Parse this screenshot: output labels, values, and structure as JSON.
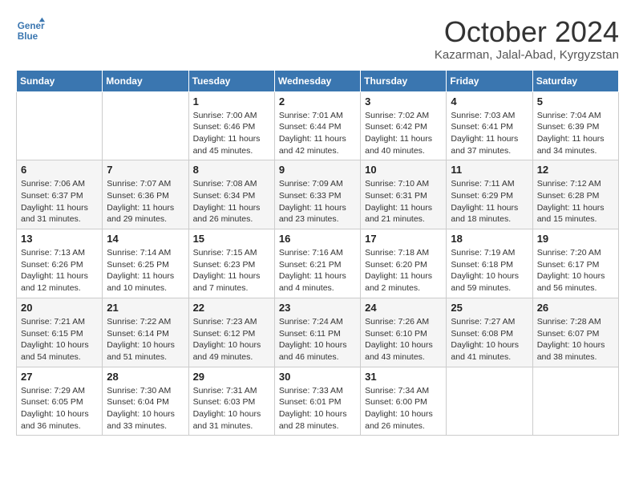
{
  "header": {
    "logo_line1": "General",
    "logo_line2": "Blue",
    "month_title": "October 2024",
    "subtitle": "Kazarman, Jalal-Abad, Kyrgyzstan"
  },
  "weekdays": [
    "Sunday",
    "Monday",
    "Tuesday",
    "Wednesday",
    "Thursday",
    "Friday",
    "Saturday"
  ],
  "weeks": [
    [
      {
        "day": "",
        "sunrise": "",
        "sunset": "",
        "daylight": ""
      },
      {
        "day": "",
        "sunrise": "",
        "sunset": "",
        "daylight": ""
      },
      {
        "day": "1",
        "sunrise": "Sunrise: 7:00 AM",
        "sunset": "Sunset: 6:46 PM",
        "daylight": "Daylight: 11 hours and 45 minutes."
      },
      {
        "day": "2",
        "sunrise": "Sunrise: 7:01 AM",
        "sunset": "Sunset: 6:44 PM",
        "daylight": "Daylight: 11 hours and 42 minutes."
      },
      {
        "day": "3",
        "sunrise": "Sunrise: 7:02 AM",
        "sunset": "Sunset: 6:42 PM",
        "daylight": "Daylight: 11 hours and 40 minutes."
      },
      {
        "day": "4",
        "sunrise": "Sunrise: 7:03 AM",
        "sunset": "Sunset: 6:41 PM",
        "daylight": "Daylight: 11 hours and 37 minutes."
      },
      {
        "day": "5",
        "sunrise": "Sunrise: 7:04 AM",
        "sunset": "Sunset: 6:39 PM",
        "daylight": "Daylight: 11 hours and 34 minutes."
      }
    ],
    [
      {
        "day": "6",
        "sunrise": "Sunrise: 7:06 AM",
        "sunset": "Sunset: 6:37 PM",
        "daylight": "Daylight: 11 hours and 31 minutes."
      },
      {
        "day": "7",
        "sunrise": "Sunrise: 7:07 AM",
        "sunset": "Sunset: 6:36 PM",
        "daylight": "Daylight: 11 hours and 29 minutes."
      },
      {
        "day": "8",
        "sunrise": "Sunrise: 7:08 AM",
        "sunset": "Sunset: 6:34 PM",
        "daylight": "Daylight: 11 hours and 26 minutes."
      },
      {
        "day": "9",
        "sunrise": "Sunrise: 7:09 AM",
        "sunset": "Sunset: 6:33 PM",
        "daylight": "Daylight: 11 hours and 23 minutes."
      },
      {
        "day": "10",
        "sunrise": "Sunrise: 7:10 AM",
        "sunset": "Sunset: 6:31 PM",
        "daylight": "Daylight: 11 hours and 21 minutes."
      },
      {
        "day": "11",
        "sunrise": "Sunrise: 7:11 AM",
        "sunset": "Sunset: 6:29 PM",
        "daylight": "Daylight: 11 hours and 18 minutes."
      },
      {
        "day": "12",
        "sunrise": "Sunrise: 7:12 AM",
        "sunset": "Sunset: 6:28 PM",
        "daylight": "Daylight: 11 hours and 15 minutes."
      }
    ],
    [
      {
        "day": "13",
        "sunrise": "Sunrise: 7:13 AM",
        "sunset": "Sunset: 6:26 PM",
        "daylight": "Daylight: 11 hours and 12 minutes."
      },
      {
        "day": "14",
        "sunrise": "Sunrise: 7:14 AM",
        "sunset": "Sunset: 6:25 PM",
        "daylight": "Daylight: 11 hours and 10 minutes."
      },
      {
        "day": "15",
        "sunrise": "Sunrise: 7:15 AM",
        "sunset": "Sunset: 6:23 PM",
        "daylight": "Daylight: 11 hours and 7 minutes."
      },
      {
        "day": "16",
        "sunrise": "Sunrise: 7:16 AM",
        "sunset": "Sunset: 6:21 PM",
        "daylight": "Daylight: 11 hours and 4 minutes."
      },
      {
        "day": "17",
        "sunrise": "Sunrise: 7:18 AM",
        "sunset": "Sunset: 6:20 PM",
        "daylight": "Daylight: 11 hours and 2 minutes."
      },
      {
        "day": "18",
        "sunrise": "Sunrise: 7:19 AM",
        "sunset": "Sunset: 6:18 PM",
        "daylight": "Daylight: 10 hours and 59 minutes."
      },
      {
        "day": "19",
        "sunrise": "Sunrise: 7:20 AM",
        "sunset": "Sunset: 6:17 PM",
        "daylight": "Daylight: 10 hours and 56 minutes."
      }
    ],
    [
      {
        "day": "20",
        "sunrise": "Sunrise: 7:21 AM",
        "sunset": "Sunset: 6:15 PM",
        "daylight": "Daylight: 10 hours and 54 minutes."
      },
      {
        "day": "21",
        "sunrise": "Sunrise: 7:22 AM",
        "sunset": "Sunset: 6:14 PM",
        "daylight": "Daylight: 10 hours and 51 minutes."
      },
      {
        "day": "22",
        "sunrise": "Sunrise: 7:23 AM",
        "sunset": "Sunset: 6:12 PM",
        "daylight": "Daylight: 10 hours and 49 minutes."
      },
      {
        "day": "23",
        "sunrise": "Sunrise: 7:24 AM",
        "sunset": "Sunset: 6:11 PM",
        "daylight": "Daylight: 10 hours and 46 minutes."
      },
      {
        "day": "24",
        "sunrise": "Sunrise: 7:26 AM",
        "sunset": "Sunset: 6:10 PM",
        "daylight": "Daylight: 10 hours and 43 minutes."
      },
      {
        "day": "25",
        "sunrise": "Sunrise: 7:27 AM",
        "sunset": "Sunset: 6:08 PM",
        "daylight": "Daylight: 10 hours and 41 minutes."
      },
      {
        "day": "26",
        "sunrise": "Sunrise: 7:28 AM",
        "sunset": "Sunset: 6:07 PM",
        "daylight": "Daylight: 10 hours and 38 minutes."
      }
    ],
    [
      {
        "day": "27",
        "sunrise": "Sunrise: 7:29 AM",
        "sunset": "Sunset: 6:05 PM",
        "daylight": "Daylight: 10 hours and 36 minutes."
      },
      {
        "day": "28",
        "sunrise": "Sunrise: 7:30 AM",
        "sunset": "Sunset: 6:04 PM",
        "daylight": "Daylight: 10 hours and 33 minutes."
      },
      {
        "day": "29",
        "sunrise": "Sunrise: 7:31 AM",
        "sunset": "Sunset: 6:03 PM",
        "daylight": "Daylight: 10 hours and 31 minutes."
      },
      {
        "day": "30",
        "sunrise": "Sunrise: 7:33 AM",
        "sunset": "Sunset: 6:01 PM",
        "daylight": "Daylight: 10 hours and 28 minutes."
      },
      {
        "day": "31",
        "sunrise": "Sunrise: 7:34 AM",
        "sunset": "Sunset: 6:00 PM",
        "daylight": "Daylight: 10 hours and 26 minutes."
      },
      {
        "day": "",
        "sunrise": "",
        "sunset": "",
        "daylight": ""
      },
      {
        "day": "",
        "sunrise": "",
        "sunset": "",
        "daylight": ""
      }
    ]
  ]
}
